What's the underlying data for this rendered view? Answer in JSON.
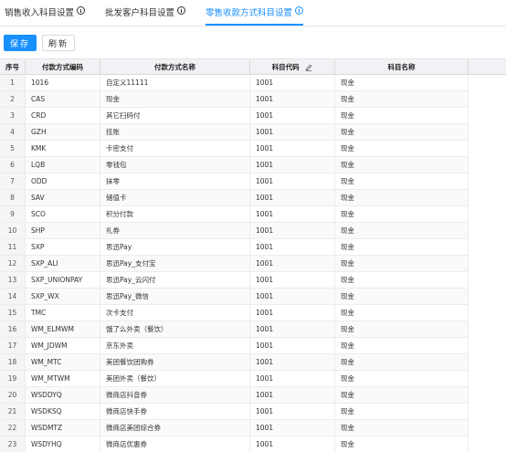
{
  "tabs": [
    {
      "label": "销售收入科目设置"
    },
    {
      "label": "批发客户科目设置"
    },
    {
      "label": "零售收款方式科目设置"
    }
  ],
  "toolbar": {
    "save_label": "保存",
    "refresh_label": "刷新"
  },
  "table": {
    "columns": [
      "序号",
      "付款方式编码",
      "付款方式名称",
      "科目代码",
      "科目名称"
    ],
    "rows": [
      [
        "1",
        "1016",
        "自定义11111",
        "1001",
        "现金"
      ],
      [
        "2",
        "CAS",
        "现金",
        "1001",
        "现金"
      ],
      [
        "3",
        "CRD",
        "其它扫码付",
        "1001",
        "现金"
      ],
      [
        "4",
        "GZH",
        "挂账",
        "1001",
        "现金"
      ],
      [
        "5",
        "KMK",
        "卡密支付",
        "1001",
        "现金"
      ],
      [
        "6",
        "LQB",
        "零钱包",
        "1001",
        "现金"
      ],
      [
        "7",
        "ODD",
        "抹零",
        "1001",
        "现金"
      ],
      [
        "8",
        "SAV",
        "储值卡",
        "1001",
        "现金"
      ],
      [
        "9",
        "SCO",
        "积分付款",
        "1001",
        "现金"
      ],
      [
        "10",
        "SHP",
        "礼券",
        "1001",
        "现金"
      ],
      [
        "11",
        "SXP",
        "思迅Pay",
        "1001",
        "现金"
      ],
      [
        "12",
        "SXP_ALI",
        "思迅Pay_支付宝",
        "1001",
        "现金"
      ],
      [
        "13",
        "SXP_UNIONPAY",
        "思迅Pay_云闪付",
        "1001",
        "现金"
      ],
      [
        "14",
        "SXP_WX",
        "思迅Pay_微信",
        "1001",
        "现金"
      ],
      [
        "15",
        "TMC",
        "次卡支付",
        "1001",
        "现金"
      ],
      [
        "16",
        "WM_ELMWM",
        "饿了么外卖（餐饮）",
        "1001",
        "现金"
      ],
      [
        "17",
        "WM_JDWM",
        "京东外卖",
        "1001",
        "现金"
      ],
      [
        "18",
        "WM_MTC",
        "美团餐饮团购券",
        "1001",
        "现金"
      ],
      [
        "19",
        "WM_MTWM",
        "美团外卖（餐饮）",
        "1001",
        "现金"
      ],
      [
        "20",
        "WSDDYQ",
        "微商店抖音券",
        "1001",
        "现金"
      ],
      [
        "21",
        "WSDKSQ",
        "微商店快手券",
        "1001",
        "现金"
      ],
      [
        "22",
        "WSDMTZ",
        "微商店美团综合券",
        "1001",
        "现金"
      ],
      [
        "23",
        "WSDYHQ",
        "微商店优惠券",
        "1001",
        "现金"
      ]
    ]
  },
  "colors": {
    "accent": "#1890ff",
    "header_bg": "#f0f2f5"
  },
  "icons": {
    "tab_info": "info-circle-icon",
    "column_edit": "edit-pencil-icon"
  }
}
